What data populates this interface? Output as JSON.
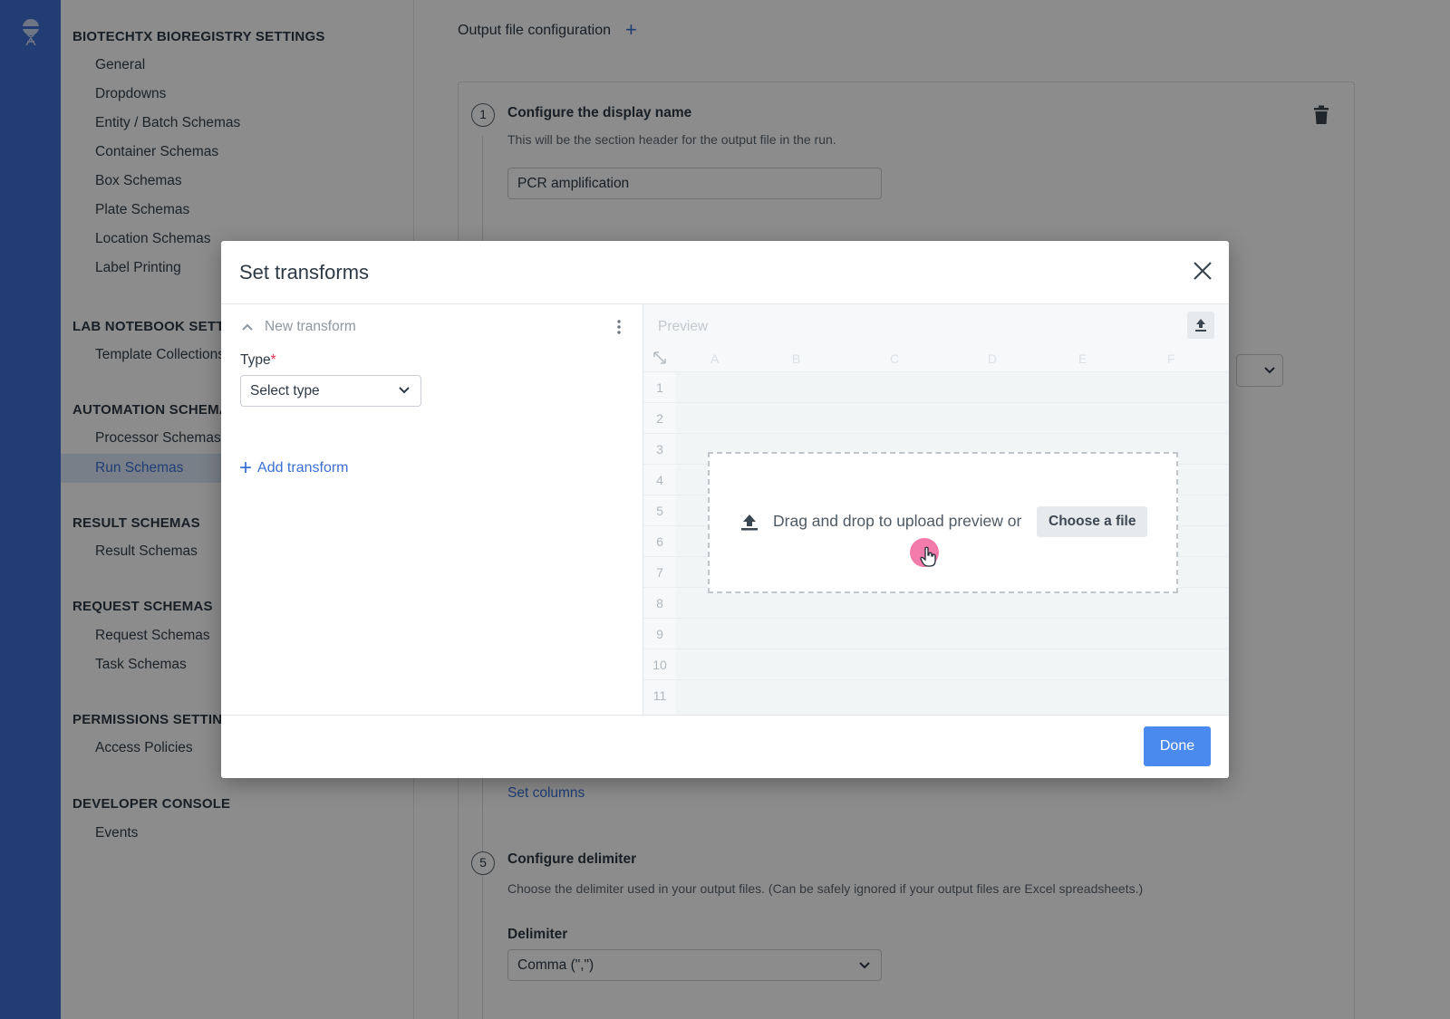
{
  "app": {
    "logo_icon": "benchling-logo-icon"
  },
  "sidebar": {
    "sections": [
      {
        "title": "BIOTECHTX BIOREGISTRY SETTINGS",
        "items": [
          "General",
          "Dropdowns",
          "Entity / Batch Schemas",
          "Container Schemas",
          "Box Schemas",
          "Plate Schemas",
          "Location Schemas",
          "Label Printing"
        ]
      },
      {
        "title": "LAB NOTEBOOK SETTINGS",
        "items": [
          "Template Collections"
        ]
      },
      {
        "title": "AUTOMATION SCHEMAS",
        "items": [
          "Processor Schemas",
          "Run Schemas"
        ]
      },
      {
        "title": "RESULT SCHEMAS",
        "items": [
          "Result Schemas"
        ]
      },
      {
        "title": "REQUEST SCHEMAS",
        "items": [
          "Request Schemas",
          "Task Schemas"
        ]
      },
      {
        "title": "PERMISSIONS SETTINGS",
        "items": [
          "Access Policies"
        ]
      },
      {
        "title": "DEVELOPER CONSOLE",
        "items": [
          "Events"
        ]
      }
    ],
    "active_item": "Run Schemas"
  },
  "main": {
    "section_title": "Output file configuration",
    "add_icon": "plus-icon",
    "step1": {
      "number": "1",
      "title": "Configure the display name",
      "description": "This will be the section header for the output file in the run.",
      "value": "PCR amplification"
    },
    "set_columns_link": "Set columns",
    "step5": {
      "number": "5",
      "title": "Configure delimiter",
      "description": "Choose the delimiter used in your output files. (Can be safely ignored if your output files are Excel spreadsheets.)",
      "field_label": "Delimiter",
      "value": "Comma (\",\")"
    }
  },
  "modal": {
    "title": "Set transforms",
    "close_icon": "close-icon",
    "transform": {
      "title": "New transform",
      "type_label": "Type",
      "required_mark": "*",
      "type_placeholder": "Select type"
    },
    "add_transform_label": "Add transform",
    "preview": {
      "title": "Preview",
      "columns": [
        "A",
        "B",
        "C",
        "D",
        "E",
        "F"
      ],
      "rows": [
        "1",
        "2",
        "3",
        "4",
        "5",
        "6",
        "7",
        "8",
        "9",
        "10",
        "11"
      ],
      "dropzone_text": "Drag and drop to upload preview or",
      "choose_file_label": "Choose a file"
    },
    "done_label": "Done"
  },
  "colors": {
    "accent": "#3b6fd3",
    "primary_button": "#4a8aef",
    "rail": "#3f6fd2",
    "required": "#e0344b"
  }
}
